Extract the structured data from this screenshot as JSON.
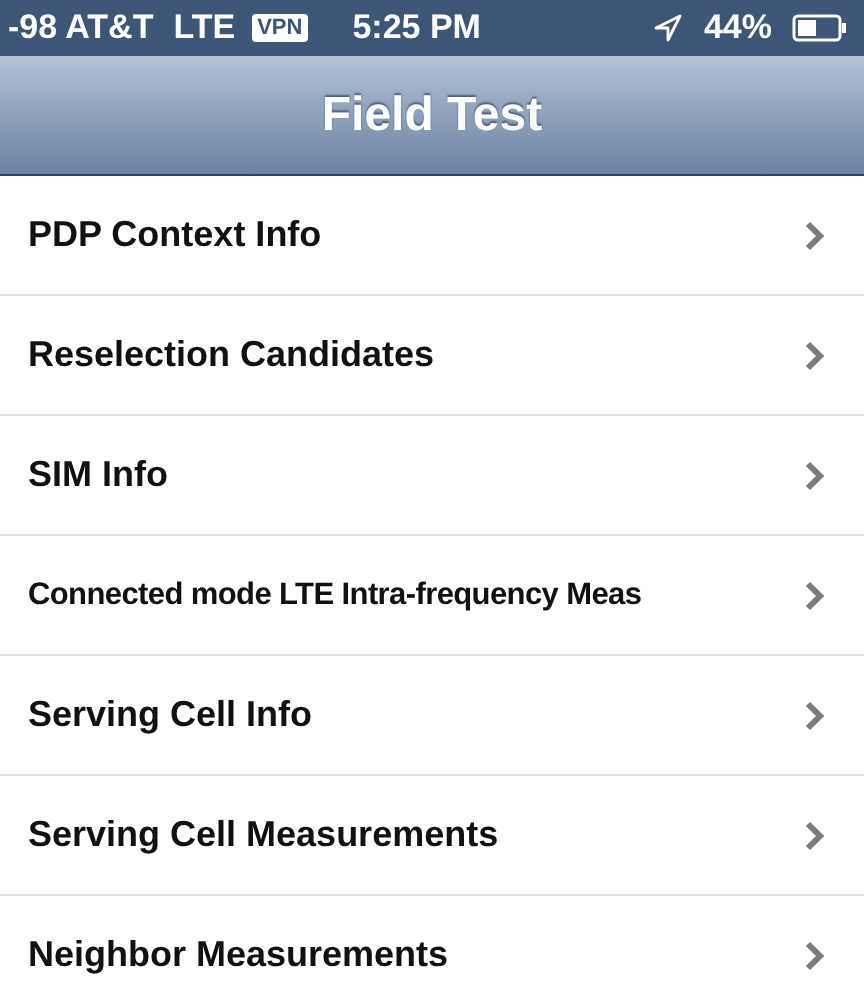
{
  "status_bar": {
    "carrier": "-98 AT&T",
    "network": "LTE",
    "vpn": "VPN",
    "time": "5:25 PM",
    "battery": "44%"
  },
  "nav_bar": {
    "title": "Field Test"
  },
  "items": [
    {
      "label": "PDP Context Info"
    },
    {
      "label": "Reselection Candidates"
    },
    {
      "label": "SIM Info"
    },
    {
      "label": "Connected mode LTE Intra-frequency Meas"
    },
    {
      "label": "Serving Cell Info"
    },
    {
      "label": "Serving Cell Measurements"
    },
    {
      "label": "Neighbor Measurements"
    }
  ]
}
